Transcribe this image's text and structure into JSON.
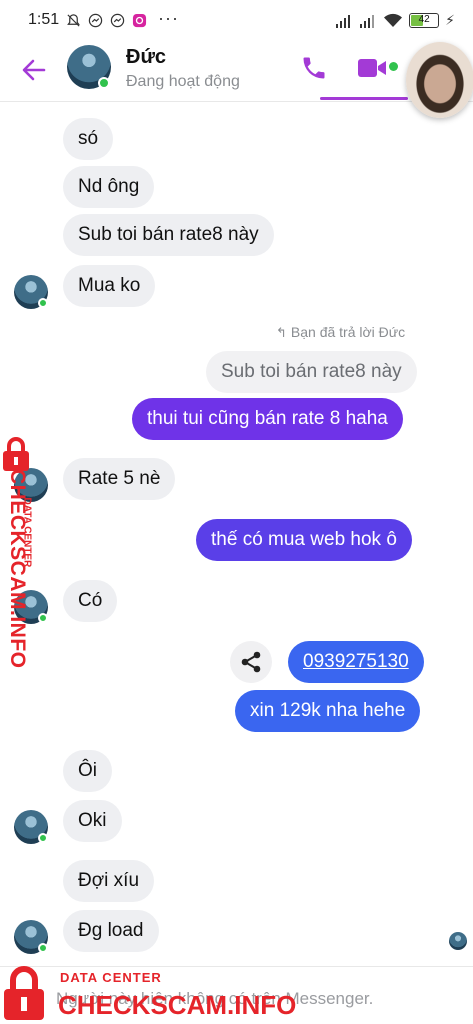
{
  "status_bar": {
    "time": "1:51",
    "battery": "42"
  },
  "header": {
    "name": "Đức",
    "status": "Đang hoạt động"
  },
  "messages": [
    {
      "text": "só"
    },
    {
      "text": "Nd ông"
    },
    {
      "text": "Sub toi bán rate8 này"
    },
    {
      "text": "Mua ko"
    },
    {
      "text": "Sub toi bán rate8 này"
    },
    {
      "text": "thui tui cũng bán rate 8 haha"
    },
    {
      "text": "Rate 5 nè"
    },
    {
      "text": "thế có mua web hok ô"
    },
    {
      "text": "Có"
    },
    {
      "text": "0939275130"
    },
    {
      "text": "xin 129k nha hehe"
    },
    {
      "text": "Ôi"
    },
    {
      "text": "Oki"
    },
    {
      "text": "Đợi xíu"
    },
    {
      "text": "Đg load"
    }
  ],
  "reply_note": "Bạn đã trả lời Đức",
  "footer": {
    "text": "Người này hiện không có trên Messenger."
  },
  "watermark": {
    "sub": "DATA CENTER",
    "main": "CHECKSCAM.INFO"
  },
  "colors": {
    "accent": "#a33ad6",
    "bubble_purple": "#6f33e8",
    "bubble_blue": "#3a66f0",
    "incoming": "#eeeff2",
    "watermark": "#e5242a"
  },
  "icons": [
    "back-arrow-icon",
    "phone-icon",
    "video-call-icon",
    "share-icon",
    "reply-arrow-icon",
    "padlock-icon"
  ]
}
